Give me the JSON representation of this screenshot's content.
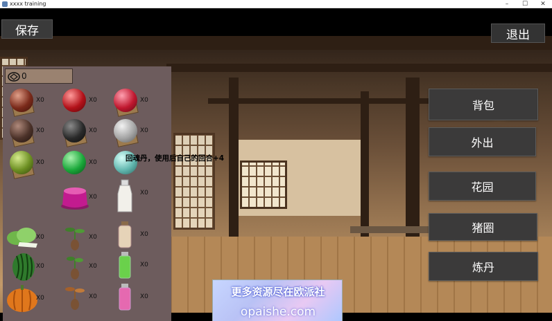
{
  "window": {
    "title": "xxxx training",
    "min": "–",
    "max": "☐",
    "close": "✕"
  },
  "top": {
    "save_label": "保存",
    "exit_label": "退出"
  },
  "money": {
    "value": "0",
    "icon": "coin-icon"
  },
  "inventory": {
    "items": [
      {
        "name": "orb-brown-red",
        "qty": "X0",
        "color": "#7a2a1a"
      },
      {
        "name": "orb-red",
        "qty": "X0",
        "color": "#b3121a"
      },
      {
        "name": "orb-crimson",
        "qty": "X0",
        "color": "#c0182f"
      },
      {
        "name": "orb-dark-brown",
        "qty": "X0",
        "color": "#4c3229"
      },
      {
        "name": "orb-black",
        "qty": "X0",
        "color": "#2a2a2a"
      },
      {
        "name": "orb-grey",
        "qty": "X0",
        "color": "#a4a4a4"
      },
      {
        "name": "orb-olive",
        "qty": "X0",
        "color": "#6c8f22"
      },
      {
        "name": "orb-green",
        "qty": "X0",
        "color": "#1aa83a"
      },
      {
        "name": "orb-teal",
        "qty": "X0",
        "color": "#63b8b0"
      },
      {
        "name": "jelly-magenta",
        "qty": "X0",
        "color": "#c21b8f"
      },
      {
        "name": "bottle-milk",
        "qty": "X0",
        "color": "#f2f0ea"
      },
      {
        "name": "bok-choy",
        "qty": "X0",
        "color": "#6fb64a"
      },
      {
        "name": "seedling-1",
        "qty": "X0",
        "color": "#3f7f2a"
      },
      {
        "name": "bottle-cream",
        "qty": "X0",
        "color": "#e6d3b8"
      },
      {
        "name": "watermelon",
        "qty": "X0",
        "color": "#2f7a2c"
      },
      {
        "name": "seedling-2",
        "qty": "X0",
        "color": "#3f7f2a"
      },
      {
        "name": "potion-green",
        "qty": "X0",
        "color": "#6ad14b"
      },
      {
        "name": "pumpkin",
        "qty": "X0",
        "color": "#e0771c"
      },
      {
        "name": "seedling-3",
        "qty": "X0",
        "color": "#a5602a"
      },
      {
        "name": "potion-pink",
        "qty": "X0",
        "color": "#e569b0"
      }
    ]
  },
  "tooltip": "回魂丹，使用后自己的回合+4",
  "menu": {
    "bag": "背包",
    "go_out": "外出",
    "garden": "花园",
    "pigpen": "猪圈",
    "alchemy": "炼丹"
  },
  "banner": {
    "line1": "更多资源尽在欧派社",
    "line2": "opaishe.com"
  }
}
